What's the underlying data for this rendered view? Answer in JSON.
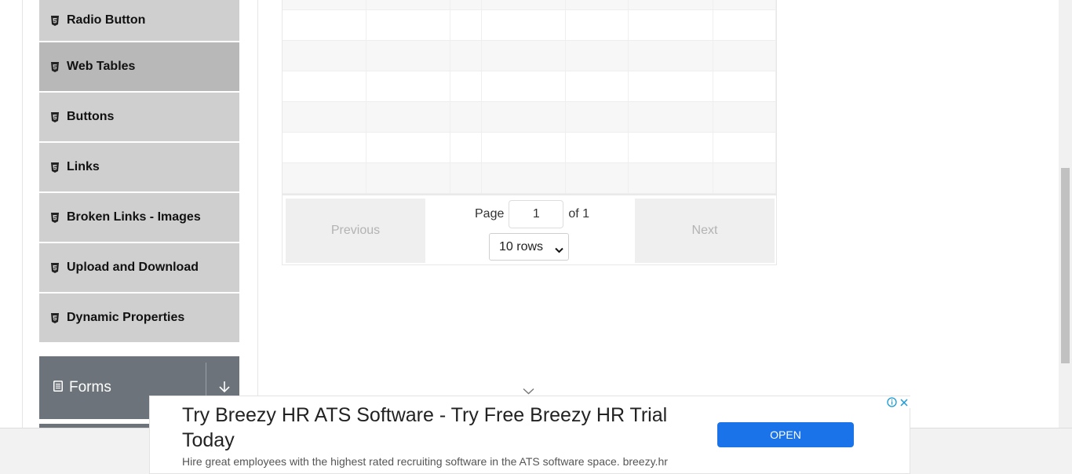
{
  "sidebar": {
    "items": [
      {
        "label": "Radio Button"
      },
      {
        "label": "Web Tables"
      },
      {
        "label": "Buttons"
      },
      {
        "label": "Links"
      },
      {
        "label": "Broken Links - Images"
      },
      {
        "label": "Upload and Download"
      },
      {
        "label": "Dynamic Properties"
      }
    ],
    "active_index": 1,
    "group": {
      "label": "Forms"
    }
  },
  "table": {
    "pagination": {
      "previous_label": "Previous",
      "next_label": "Next",
      "page_label": "Page",
      "page_value": "1",
      "of_label": "of 1",
      "rows_selected": "10 rows"
    }
  },
  "ad": {
    "title": "Try Breezy HR ATS Software - Try Free Breezy HR Trial Today",
    "description": "Hire great employees with the highest rated recruiting software in the ATS software space. breezy.hr",
    "button_label": "OPEN",
    "button_color": "#1a73e8"
  },
  "colors": {
    "menu_item_bg": "#cfcfcf",
    "menu_item_active_bg": "#b8b8b8",
    "group_header_bg": "#6c737b"
  }
}
